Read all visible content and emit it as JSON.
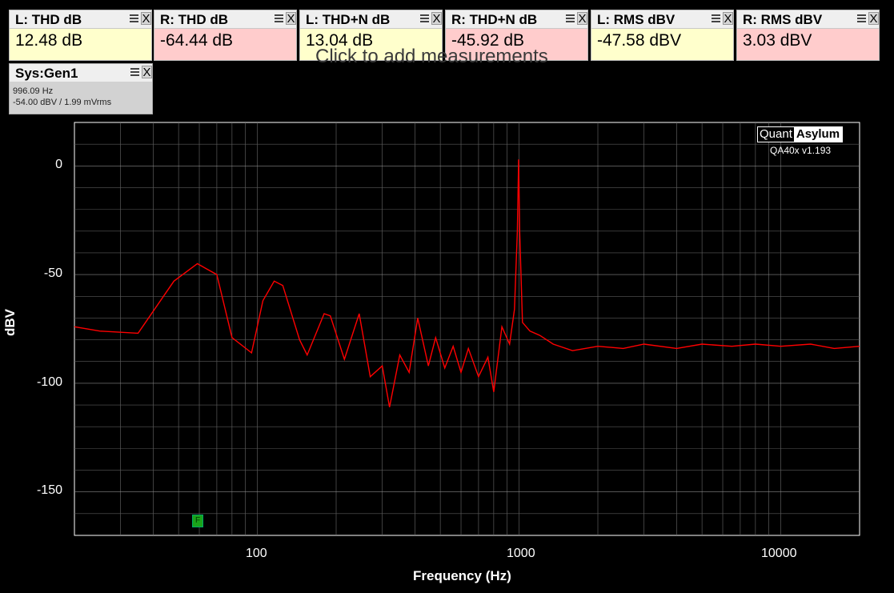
{
  "measurements": [
    {
      "title": "L: THD dB",
      "value": "12.48 dB",
      "bg": "#ffffcc"
    },
    {
      "title": "R: THD dB",
      "value": "-64.44 dB",
      "bg": "#ffcccc"
    },
    {
      "title": "L: THD+N dB",
      "value": "13.04 dB",
      "bg": "#ffffcc"
    },
    {
      "title": "R: THD+N dB",
      "value": "-45.92 dB",
      "bg": "#ffcccc"
    },
    {
      "title": "L: RMS dBV",
      "value": "-47.58 dBV",
      "bg": "#ffffcc"
    },
    {
      "title": "R: RMS dBV",
      "value": "3.03 dBV",
      "bg": "#ffcccc"
    }
  ],
  "add_measurement_hint": "Click to add measurements",
  "generator": {
    "title": "Sys:Gen1",
    "frequency": "996.09 Hz",
    "level": "-54.00 dBV  / 1.99 mVrms"
  },
  "close_glyph": "X",
  "logo": {
    "left": "Quant",
    "right": "Asylum",
    "version": "QA40x v1.193"
  },
  "marker_label": "F",
  "chart_data": {
    "type": "line",
    "xlabel": "Frequency (Hz)",
    "ylabel": "dBV",
    "x_scale": "log",
    "xlim": [
      20,
      20000
    ],
    "ylim": [
      -170,
      20
    ],
    "x_tick_labels": [
      "100",
      "1000",
      "10000"
    ],
    "y_tick_labels": [
      "0",
      "-50",
      "-100",
      "-150"
    ],
    "grid": true,
    "series": [
      {
        "color": "#ff0000",
        "points": [
          [
            20,
            -74
          ],
          [
            25,
            -76
          ],
          [
            35,
            -77
          ],
          [
            48,
            -53
          ],
          [
            59,
            -45
          ],
          [
            70,
            -50
          ],
          [
            80,
            -79
          ],
          [
            95,
            -86
          ],
          [
            105,
            -62
          ],
          [
            116,
            -53
          ],
          [
            125,
            -55
          ],
          [
            145,
            -80
          ],
          [
            155,
            -87
          ],
          [
            180,
            -68
          ],
          [
            190,
            -69
          ],
          [
            215,
            -89
          ],
          [
            245,
            -68
          ],
          [
            270,
            -97
          ],
          [
            300,
            -92
          ],
          [
            320,
            -111
          ],
          [
            350,
            -87
          ],
          [
            380,
            -95
          ],
          [
            410,
            -70
          ],
          [
            450,
            -92
          ],
          [
            480,
            -79
          ],
          [
            520,
            -93
          ],
          [
            560,
            -83
          ],
          [
            600,
            -95
          ],
          [
            640,
            -84
          ],
          [
            700,
            -97
          ],
          [
            760,
            -88
          ],
          [
            800,
            -104
          ],
          [
            860,
            -74
          ],
          [
            920,
            -82
          ],
          [
            960,
            -66
          ],
          [
            985,
            -30
          ],
          [
            996,
            3
          ],
          [
            1005,
            -30
          ],
          [
            1030,
            -72
          ],
          [
            1100,
            -76
          ],
          [
            1200,
            -78
          ],
          [
            1350,
            -82
          ],
          [
            1600,
            -85
          ],
          [
            2000,
            -83
          ],
          [
            2500,
            -84
          ],
          [
            3000,
            -82
          ],
          [
            4000,
            -84
          ],
          [
            5000,
            -82
          ],
          [
            6500,
            -83
          ],
          [
            8000,
            -82
          ],
          [
            10000,
            -83
          ],
          [
            13000,
            -82
          ],
          [
            16000,
            -84
          ],
          [
            20000,
            -83
          ]
        ]
      }
    ]
  }
}
